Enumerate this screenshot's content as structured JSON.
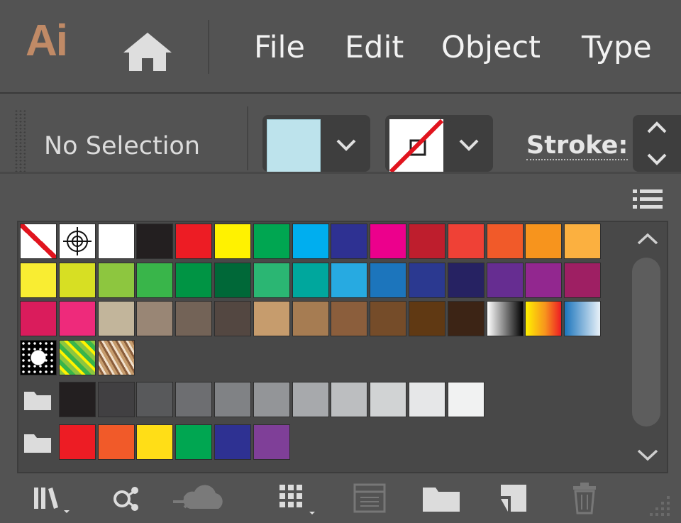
{
  "app": {
    "logo": "Ai"
  },
  "menu": {
    "items": [
      "File",
      "Edit",
      "Object",
      "Type"
    ]
  },
  "control_bar": {
    "selection_text": "No Selection",
    "fill_color": "#bde3ec",
    "stroke_label": "Stroke:"
  },
  "swatches": {
    "rows": [
      [
        "none",
        "registration",
        "#ffffff",
        "#231f20",
        "#ed1c24",
        "#fff200",
        "#00a651",
        "#00aeef",
        "#2e3192",
        "#ec008c",
        "#be1e2d",
        "#ef4136",
        "#f15a29",
        "#f7941d",
        "#fbb040"
      ],
      [
        "#f9ed32",
        "#d7df23",
        "#8dc63f",
        "#39b54a",
        "#009444",
        "#006838",
        "#2bb673",
        "#00a79d",
        "#27aae1",
        "#1c75bc",
        "#2b3990",
        "#262262",
        "#662d91",
        "#92278f",
        "#9e1f63"
      ],
      [
        "#da1c5c",
        "#ee2a7b",
        "#c2b59b",
        "#998675",
        "#736357",
        "#534741",
        "#c69c6d",
        "#a67c52",
        "#8b5e3c",
        "#754c29",
        "#603913",
        "#3c2415",
        "gradient-black-white",
        "gradient-orange-yellow",
        "pattern-blue-halftone"
      ],
      [
        "pattern-black-dots",
        "pattern-green-leaves",
        "pattern-brown-texture"
      ]
    ],
    "groups": [
      {
        "type": "folder",
        "colors": [
          "#231f20",
          "#414042",
          "#58595b",
          "#6d6e71",
          "#808285",
          "#939598",
          "#a7a9ac",
          "#bcbec0",
          "#d1d3d4",
          "#e6e7e8",
          "#f1f2f2"
        ]
      },
      {
        "type": "folder",
        "colors": [
          "#ed1c24",
          "#f15a29",
          "#ffde17",
          "#00a651",
          "#2e3192",
          "#7f3f98"
        ]
      }
    ]
  },
  "toolbar": {
    "icons": [
      "libraries-icon",
      "show-kinds-icon",
      "cloud-sync-icon",
      "swatch-options-icon",
      "color-group-icon",
      "new-group-folder-icon",
      "new-swatch-icon",
      "trash-icon"
    ]
  }
}
